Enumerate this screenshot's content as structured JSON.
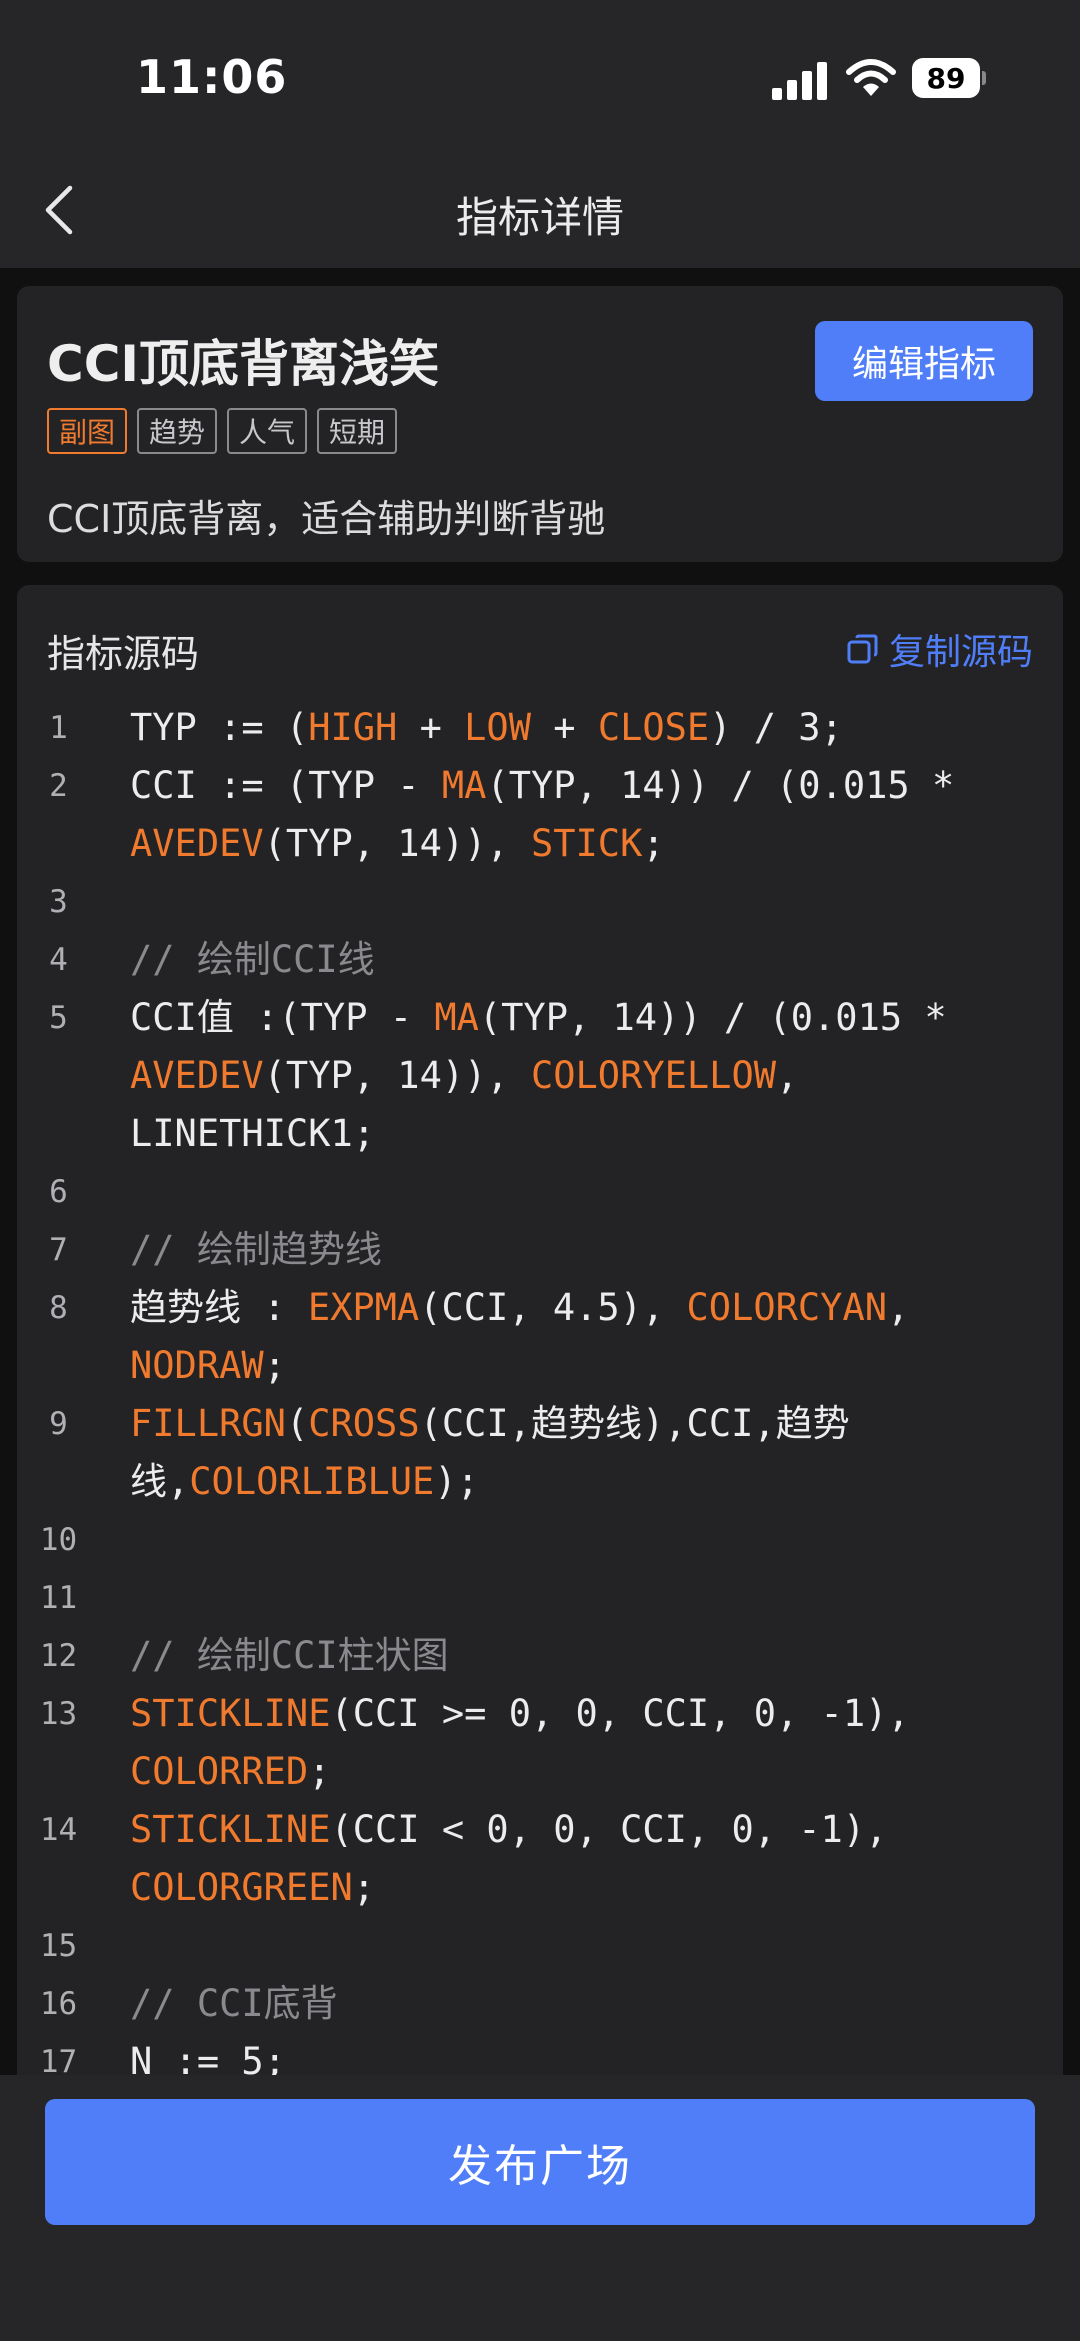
{
  "status_bar": {
    "time": "11:06",
    "battery": "89",
    "icons": [
      "signal-icon",
      "wifi-icon",
      "battery-icon"
    ]
  },
  "nav": {
    "title": "指标详情",
    "back_icon": "chevron-left-icon"
  },
  "indicator": {
    "title": "CCI顶底背离浅笑",
    "edit_label": "编辑指标",
    "tags": [
      "副图",
      "趋势",
      "人气",
      "短期"
    ],
    "description": "CCI顶底背离，适合辅助判断背驰"
  },
  "source": {
    "title": "指标源码",
    "copy_label": "复制源码",
    "copy_icon": "copy-icon",
    "lines": [
      {
        "no": "1",
        "segments": [
          [
            "t",
            "TYP := ("
          ],
          [
            "f",
            "HIGH"
          ],
          [
            "t",
            " + "
          ],
          [
            "f",
            "LOW"
          ],
          [
            "t",
            " + "
          ],
          [
            "f",
            "CLOSE"
          ],
          [
            "t",
            ") / 3;"
          ]
        ]
      },
      {
        "no": "2",
        "segments": [
          [
            "t",
            "CCI := (TYP - "
          ],
          [
            "f",
            "MA"
          ],
          [
            "t",
            "(TYP, 14)) / (0.015 * "
          ],
          [
            "f",
            "AVEDEV"
          ],
          [
            "t",
            "(TYP, 14)), "
          ],
          [
            "f",
            "STICK"
          ],
          [
            "t",
            ";"
          ]
        ]
      },
      {
        "no": "3",
        "segments": []
      },
      {
        "no": "4",
        "segments": [
          [
            "c",
            "// 绘制CCI线"
          ]
        ]
      },
      {
        "no": "5",
        "segments": [
          [
            "t",
            "CCI值 :(TYP - "
          ],
          [
            "f",
            "MA"
          ],
          [
            "t",
            "(TYP, 14)) / (0.015 * "
          ],
          [
            "f",
            "AVEDEV"
          ],
          [
            "t",
            "(TYP, 14)), "
          ],
          [
            "f",
            "COLORYELLOW"
          ],
          [
            "t",
            ", LINETHICK1;"
          ]
        ]
      },
      {
        "no": "6",
        "segments": []
      },
      {
        "no": "7",
        "segments": [
          [
            "c",
            "// 绘制趋势线"
          ]
        ]
      },
      {
        "no": "8",
        "segments": [
          [
            "t",
            "趋势线 : "
          ],
          [
            "f",
            "EXPMA"
          ],
          [
            "t",
            "(CCI, 4.5), "
          ],
          [
            "f",
            "COLORCYAN"
          ],
          [
            "t",
            ", "
          ],
          [
            "f",
            "NODRAW"
          ],
          [
            "t",
            ";"
          ]
        ]
      },
      {
        "no": "9",
        "segments": [
          [
            "f",
            "FILLRGN"
          ],
          [
            "t",
            "("
          ],
          [
            "f",
            "CROSS"
          ],
          [
            "t",
            "(CCI,趋势线),CCI,趋势线,"
          ],
          [
            "f",
            "COLORLIBLUE"
          ],
          [
            "t",
            ");"
          ]
        ]
      },
      {
        "no": "10",
        "segments": []
      },
      {
        "no": "11",
        "segments": []
      },
      {
        "no": "12",
        "segments": [
          [
            "c",
            "// 绘制CCI柱状图"
          ]
        ]
      },
      {
        "no": "13",
        "segments": [
          [
            "f",
            "STICKLINE"
          ],
          [
            "t",
            "(CCI >= 0, 0, CCI, 0, -1), "
          ],
          [
            "f",
            "COLORRED"
          ],
          [
            "t",
            ";"
          ]
        ]
      },
      {
        "no": "14",
        "segments": [
          [
            "f",
            "STICKLINE"
          ],
          [
            "t",
            "(CCI < 0, 0, CCI, 0, -1), "
          ],
          [
            "f",
            "COLORGREEN"
          ],
          [
            "t",
            ";"
          ]
        ]
      },
      {
        "no": "15",
        "segments": []
      },
      {
        "no": "16",
        "segments": [
          [
            "c",
            "// CCI底背"
          ]
        ]
      },
      {
        "no": "17",
        "segments": [
          [
            "t",
            "N := 5;"
          ]
        ]
      }
    ]
  },
  "footer": {
    "publish_label": "发布广场"
  },
  "colors": {
    "accent": "#4f7ef8",
    "keyword": "#f07a2e",
    "comment": "#8a8a8e"
  }
}
